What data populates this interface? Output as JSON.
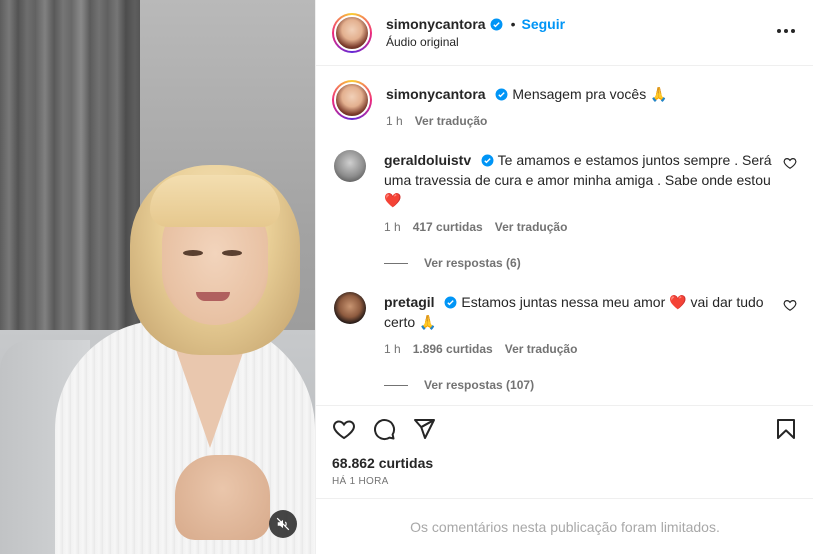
{
  "post": {
    "author": {
      "username": "simonycantora",
      "verified": true,
      "subtitle": "Áudio original"
    },
    "follow_label": "Seguir",
    "header_separator": "•",
    "caption": {
      "username": "simonycantora",
      "text": "Mensagem pra vocês 🙏",
      "time": "1 h",
      "translate_label": "Ver tradução"
    },
    "comments": [
      {
        "username": "geraldoluistv",
        "verified": true,
        "text": "Te amamos e estamos juntos sempre . Será uma travessia de cura e amor minha amiga . Sabe onde estou ❤️",
        "time": "1 h",
        "likes": "417 curtidas",
        "translate_label": "Ver tradução",
        "replies_label": "Ver respostas (6)"
      },
      {
        "username": "pretagil",
        "verified": true,
        "text": "Estamos juntas nessa meu amor ❤️ vai dar tudo certo 🙏",
        "time": "1 h",
        "likes": "1.896 curtidas",
        "translate_label": "Ver tradução",
        "replies_label": "Ver respostas (107)"
      }
    ],
    "likes_total": "68.862 curtidas",
    "posted_time": "HÁ 1 HORA",
    "comments_limited_notice": "Os comentários nesta publicação foram limitados."
  },
  "icons": {
    "like": "heart-icon",
    "comment": "comment-icon",
    "share": "share-icon",
    "save": "bookmark-icon",
    "more": "more-options-icon",
    "mute": "muted-speaker-icon",
    "verified": "verified-badge-icon"
  },
  "colors": {
    "accent": "#0095f6",
    "text": "#262626",
    "secondary": "#737373",
    "verified": "#0095f6",
    "muted": "#a8a8a8"
  }
}
